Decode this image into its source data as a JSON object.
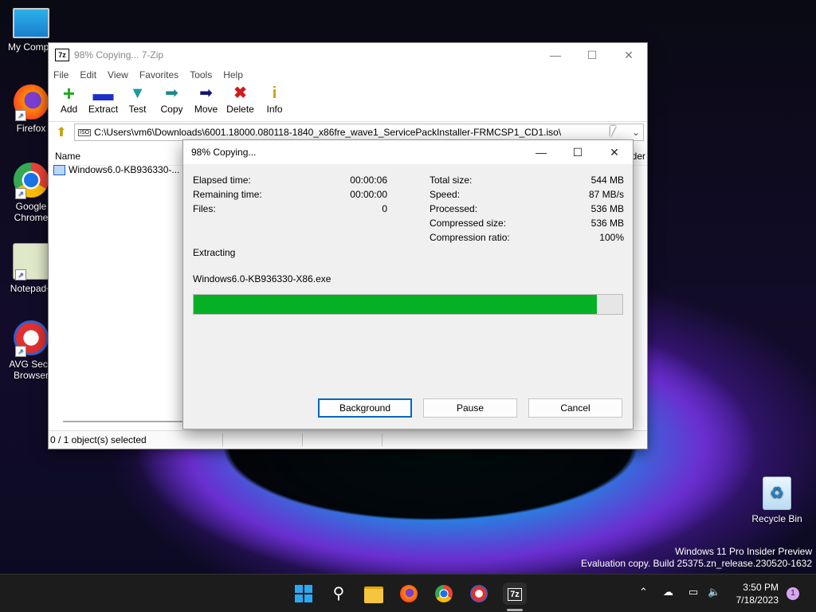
{
  "desktop": {
    "icons": [
      {
        "label": "My Compu"
      },
      {
        "label": "Firefox"
      },
      {
        "label": "Google Chrome"
      },
      {
        "label": "Notepad+"
      },
      {
        "label": "AVG Secu Browser"
      },
      {
        "label": "Recycle Bin"
      }
    ],
    "watermark_line1": "Windows 11 Pro Insider Preview",
    "watermark_line2": "Evaluation copy. Build 25375.zn_release.230520-1632"
  },
  "sevenzip": {
    "title": "98% Copying... 7-Zip",
    "title_icon": "7z",
    "menu": [
      "File",
      "Edit",
      "View",
      "Favorites",
      "Tools",
      "Help"
    ],
    "toolbar": [
      {
        "label": "Add",
        "icon": "plus-icon",
        "color": "#1fa81f"
      },
      {
        "label": "Extract",
        "icon": "minus-icon",
        "color": "#1a2fc8"
      },
      {
        "label": "Test",
        "icon": "check-icon",
        "color": "#1a9aa0"
      },
      {
        "label": "Copy",
        "icon": "copy-arrow-icon",
        "color": "#1a8a8a"
      },
      {
        "label": "Move",
        "icon": "move-arrow-icon",
        "color": "#14147a"
      },
      {
        "label": "Delete",
        "icon": "delete-x-icon",
        "color": "#d01a1a"
      },
      {
        "label": "Info",
        "icon": "info-icon",
        "color": "#c8a000"
      }
    ],
    "address": "C:\\Users\\vm6\\Downloads\\6001.18000.080118-1840_x86fre_wave1_ServicePackInstaller-FRMCSP1_CD1.iso\\",
    "address_icon_label": "ISO",
    "column_name": "Name",
    "column_partial": "der",
    "file_name": "Windows6.0-KB936330-...",
    "status": "0 / 1 object(s) selected"
  },
  "dialog": {
    "title": "98% Copying...",
    "left_stats": [
      {
        "label": "Elapsed time:",
        "value": "00:00:06"
      },
      {
        "label": "Remaining time:",
        "value": "00:00:00"
      },
      {
        "label": "Files:",
        "value": "0"
      }
    ],
    "right_stats": [
      {
        "label": "Total size:",
        "value": "544 MB"
      },
      {
        "label": "Speed:",
        "value": "87 MB/s"
      },
      {
        "label": "Processed:",
        "value": "536 MB"
      },
      {
        "label": "Compressed size:",
        "value": "536 MB"
      },
      {
        "label": "Compression ratio:",
        "value": "100%"
      }
    ],
    "operation": "Extracting",
    "current_file": "Windows6.0-KB936330-X86.exe",
    "progress": 0.94,
    "progress_color": "#06b025",
    "buttons": {
      "background": "Background",
      "pause": "Pause",
      "cancel": "Cancel"
    }
  },
  "taskbar": {
    "apps": [
      "start-icon",
      "search-icon",
      "file-explorer-icon",
      "firefox-icon",
      "chrome-icon",
      "avg-browser-icon",
      "7zip-icon"
    ],
    "sevenzip_label": "7z",
    "time": "3:50 PM",
    "date": "7/18/2023",
    "notification_count": "1"
  }
}
